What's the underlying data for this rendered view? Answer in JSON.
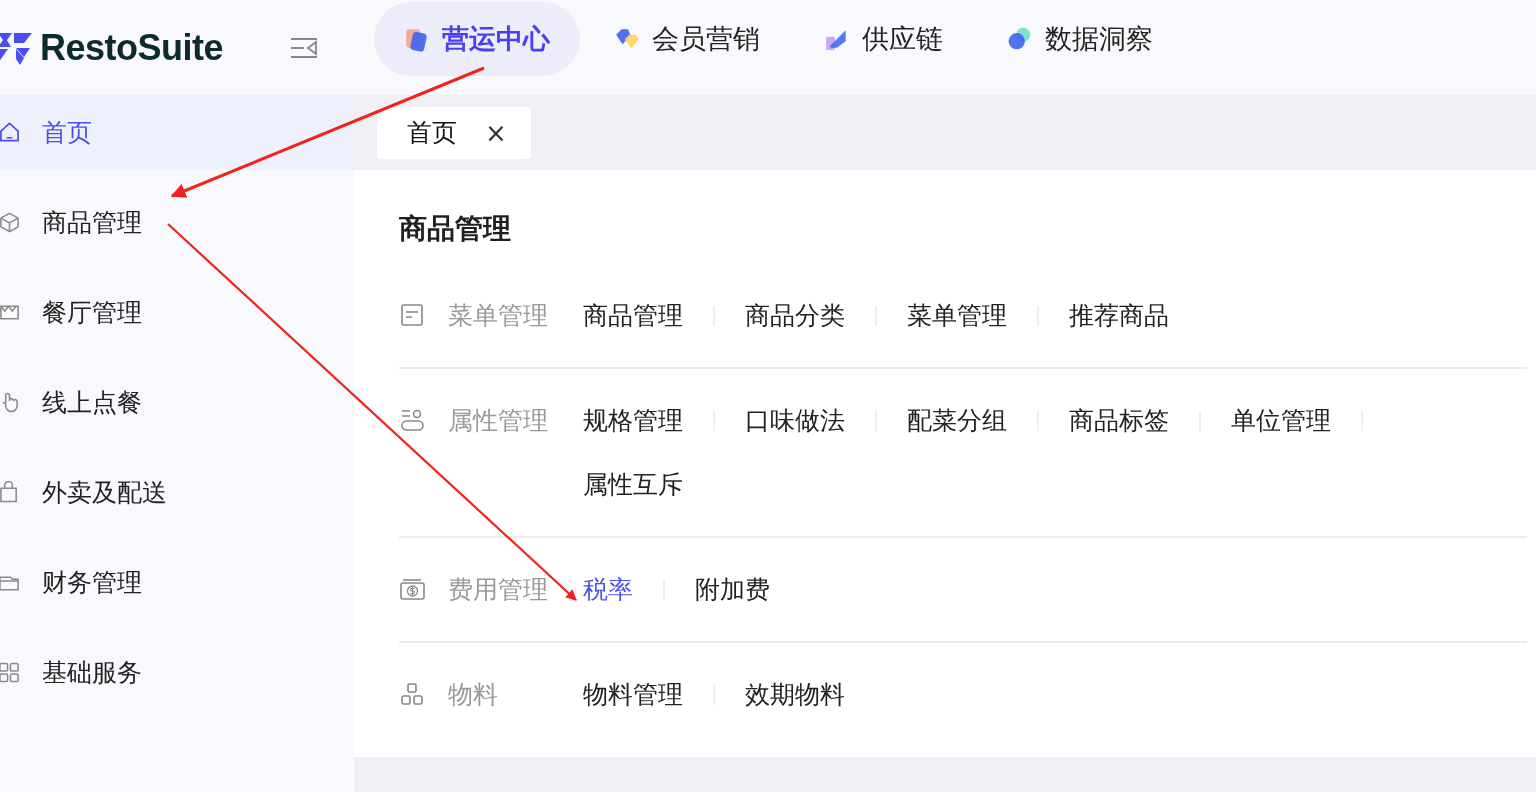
{
  "logo": {
    "text": "RestoSuite"
  },
  "top_nav": [
    {
      "label": "营运中心",
      "selected": true
    },
    {
      "label": "会员营销",
      "selected": false
    },
    {
      "label": "供应链",
      "selected": false
    },
    {
      "label": "数据洞察",
      "selected": false
    }
  ],
  "sidebar": {
    "items": [
      {
        "label": "首页",
        "kind": "home",
        "selected": true
      },
      {
        "label": "商品管理",
        "kind": "box",
        "selected": false
      },
      {
        "label": "餐厅管理",
        "kind": "store",
        "selected": false
      },
      {
        "label": "线上点餐",
        "kind": "hand",
        "selected": false
      },
      {
        "label": "外卖及配送",
        "kind": "bag",
        "selected": false
      },
      {
        "label": "财务管理",
        "kind": "wallet",
        "selected": false
      },
      {
        "label": "基础服务",
        "kind": "grid",
        "selected": false
      }
    ]
  },
  "tabs": [
    {
      "label": "首页",
      "close": "×",
      "selected": true
    }
  ],
  "panel": {
    "title": "商品管理",
    "sections": [
      {
        "label": "菜单管理",
        "kind": "doc",
        "links": [
          {
            "label": "商品管理",
            "selected": false
          },
          {
            "label": "商品分类",
            "selected": false
          },
          {
            "label": "菜单管理",
            "selected": false
          },
          {
            "label": "推荐商品",
            "selected": false
          }
        ]
      },
      {
        "label": "属性管理",
        "kind": "attr",
        "links": [
          {
            "label": "规格管理",
            "selected": false
          },
          {
            "label": "口味做法",
            "selected": false
          },
          {
            "label": "配菜分组",
            "selected": false
          },
          {
            "label": "商品标签",
            "selected": false
          },
          {
            "label": "单位管理",
            "selected": false
          },
          {
            "label": "属性互斥",
            "selected": false
          }
        ]
      },
      {
        "label": "费用管理",
        "kind": "money",
        "links": [
          {
            "label": "税率",
            "selected": true
          },
          {
            "label": "附加费",
            "selected": false
          }
        ]
      },
      {
        "label": "物料",
        "kind": "blocks",
        "links": [
          {
            "label": "物料管理",
            "selected": false
          },
          {
            "label": "效期物料",
            "selected": false
          }
        ]
      }
    ]
  }
}
